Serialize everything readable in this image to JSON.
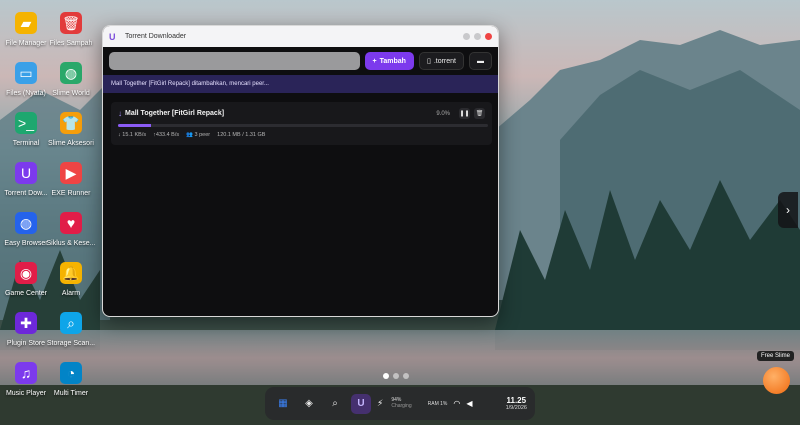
{
  "desktop": {
    "icons": [
      {
        "label": "File Manager",
        "icon": "folder-icon",
        "color": "#f5b301"
      },
      {
        "label": "Files Sampah",
        "icon": "trash-icon",
        "color": "#e23b3b"
      },
      {
        "label": "Files (Nyata)",
        "icon": "drive-icon",
        "color": "#3aa0e8"
      },
      {
        "label": "Slime World",
        "icon": "globe-icon",
        "color": "#2aa86a"
      },
      {
        "label": "Terminal",
        "icon": "terminal-icon",
        "color": "#1ea76f"
      },
      {
        "label": "Slime Aksesori",
        "icon": "shirt-icon",
        "color": "#f59e0b"
      },
      {
        "label": "Torrent Dow...",
        "icon": "magnet-icon",
        "color": "#7c3aed"
      },
      {
        "label": "EXE Runner",
        "icon": "play-icon",
        "color": "#ef4444"
      },
      {
        "label": "Easy Browser",
        "icon": "globe-icon",
        "color": "#2563eb"
      },
      {
        "label": "Siklus & Kese...",
        "icon": "heart-icon",
        "color": "#e11d48"
      },
      {
        "label": "Game Center",
        "icon": "gamepad-icon",
        "color": "#e11d48"
      },
      {
        "label": "Alarm",
        "icon": "bell-icon",
        "color": "#f5b301"
      },
      {
        "label": "Plugin Store",
        "icon": "puzzle-icon",
        "color": "#6d28d9"
      },
      {
        "label": "Storage Scan...",
        "icon": "magnifier-icon",
        "color": "#0ea5e9"
      },
      {
        "label": "Music Player",
        "icon": "headphones-icon",
        "color": "#7c3aed"
      },
      {
        "label": "Multi Timer",
        "icon": "timer-icon",
        "color": "#0284c7"
      }
    ]
  },
  "window": {
    "title": "Torrent Downloader",
    "url_input": {
      "value": "",
      "placeholder": ""
    },
    "add_button": "Tambah",
    "torrent_button": ".torrent",
    "notice": "Mall Together [FitGirl Repack] ditambahkan, mencari peer...",
    "download": {
      "name": "Mall Together [FitGirl Repack]",
      "percent_text": "9.0%",
      "progress": 0.09,
      "down_speed": "15.1 KB/s",
      "up_speed": "433.4 B/s",
      "peers": "3 peer",
      "size": "120.1 MB / 1.31 GB"
    }
  },
  "slime": {
    "label": "Free Slime"
  },
  "taskbar": {
    "battery_percent": "94%",
    "battery_status": "Charging",
    "ram": "RAM 1%",
    "time": "11.25",
    "date": "1/9/2026"
  }
}
